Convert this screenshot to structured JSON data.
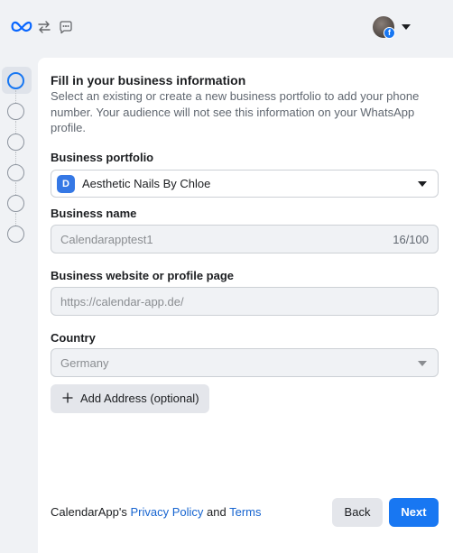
{
  "topbar": {
    "icons": [
      "meta-logo-icon",
      "swap-icon",
      "whatsapp-icon"
    ],
    "account_badge": "f"
  },
  "stepper": {
    "active_step": 1,
    "total_steps": 6
  },
  "form": {
    "title": "Fill in your business information",
    "description": "Select an existing or create a new business portfolio to add your phone number. Your audience will not see this information on your WhatsApp profile.",
    "portfolio": {
      "label": "Business portfolio",
      "avatar_letter": "D",
      "value": "Aesthetic Nails By Chloe"
    },
    "business_name": {
      "label": "Business name",
      "value": "Calendarapptest1",
      "counter": "16/100"
    },
    "website": {
      "label": "Business website or profile page",
      "value": "https://calendar-app.de/"
    },
    "country": {
      "label": "Country",
      "value": "Germany"
    },
    "add_address_label": "Add Address (optional)"
  },
  "footer": {
    "prefix": "CalendarApp's ",
    "privacy_link": "Privacy Policy",
    "conjunction": " and ",
    "terms_link": "Terms",
    "back_label": "Back",
    "next_label": "Next"
  },
  "colors": {
    "accent": "#1877f2",
    "link": "#1664d0",
    "background": "#f0f2f5"
  }
}
